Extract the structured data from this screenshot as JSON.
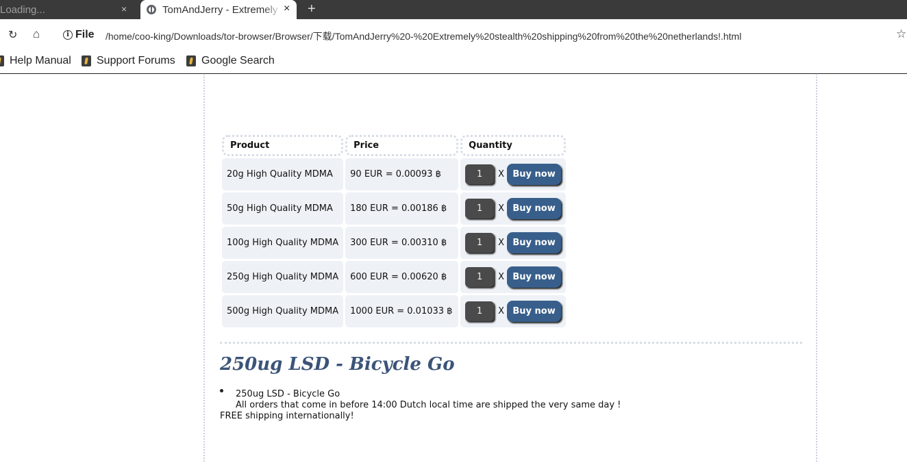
{
  "browser": {
    "tabs": [
      {
        "title": "Loading...",
        "close": "×"
      },
      {
        "title": "TomAndJerry - Extremely stealth shipping from the netherlands!",
        "close": "×"
      }
    ],
    "new_tab": "+",
    "toolbar": {
      "file_label": "File",
      "url": "/home/coo-king/Downloads/tor-browser/Browser/下载/TomAndJerry%20-%20Extremely%20stealth%20shipping%20from%20the%20netherlands!.html"
    },
    "bookmarks": [
      {
        "label": "Help Manual"
      },
      {
        "label": "Support Forums"
      },
      {
        "label": "Google Search"
      }
    ]
  },
  "table": {
    "headers": [
      "Product",
      "Price",
      "Quantity"
    ],
    "rows": [
      {
        "product": "20g High Quality MDMA",
        "price": "90 EUR = 0.00093 ฿",
        "qty": "1",
        "buy": "Buy now"
      },
      {
        "product": "50g High Quality MDMA",
        "price": "180 EUR = 0.00186 ฿",
        "qty": "1",
        "buy": "Buy now"
      },
      {
        "product": "100g High Quality MDMA",
        "price": "300 EUR = 0.00310 ฿",
        "qty": "1",
        "buy": "Buy now"
      },
      {
        "product": "250g High Quality MDMA",
        "price": "600 EUR = 0.00620 ฿",
        "qty": "1",
        "buy": "Buy now"
      },
      {
        "product": "500g High Quality MDMA",
        "price": "1000 EUR = 0.01033 ฿",
        "qty": "1",
        "buy": "Buy now"
      }
    ],
    "times_symbol": "X"
  },
  "next_product": {
    "title": "250ug LSD - Bicycle Go",
    "lines": [
      "250ug LSD - Bicycle Go",
      "All orders that come in before 14:00 Dutch local time are shipped the very same day !",
      "FREE shipping internationally!"
    ]
  },
  "icons": {
    "reload": "reload-icon",
    "home": "home-icon",
    "info": "info-icon",
    "star": "star-icon",
    "globe": "globe-icon"
  }
}
